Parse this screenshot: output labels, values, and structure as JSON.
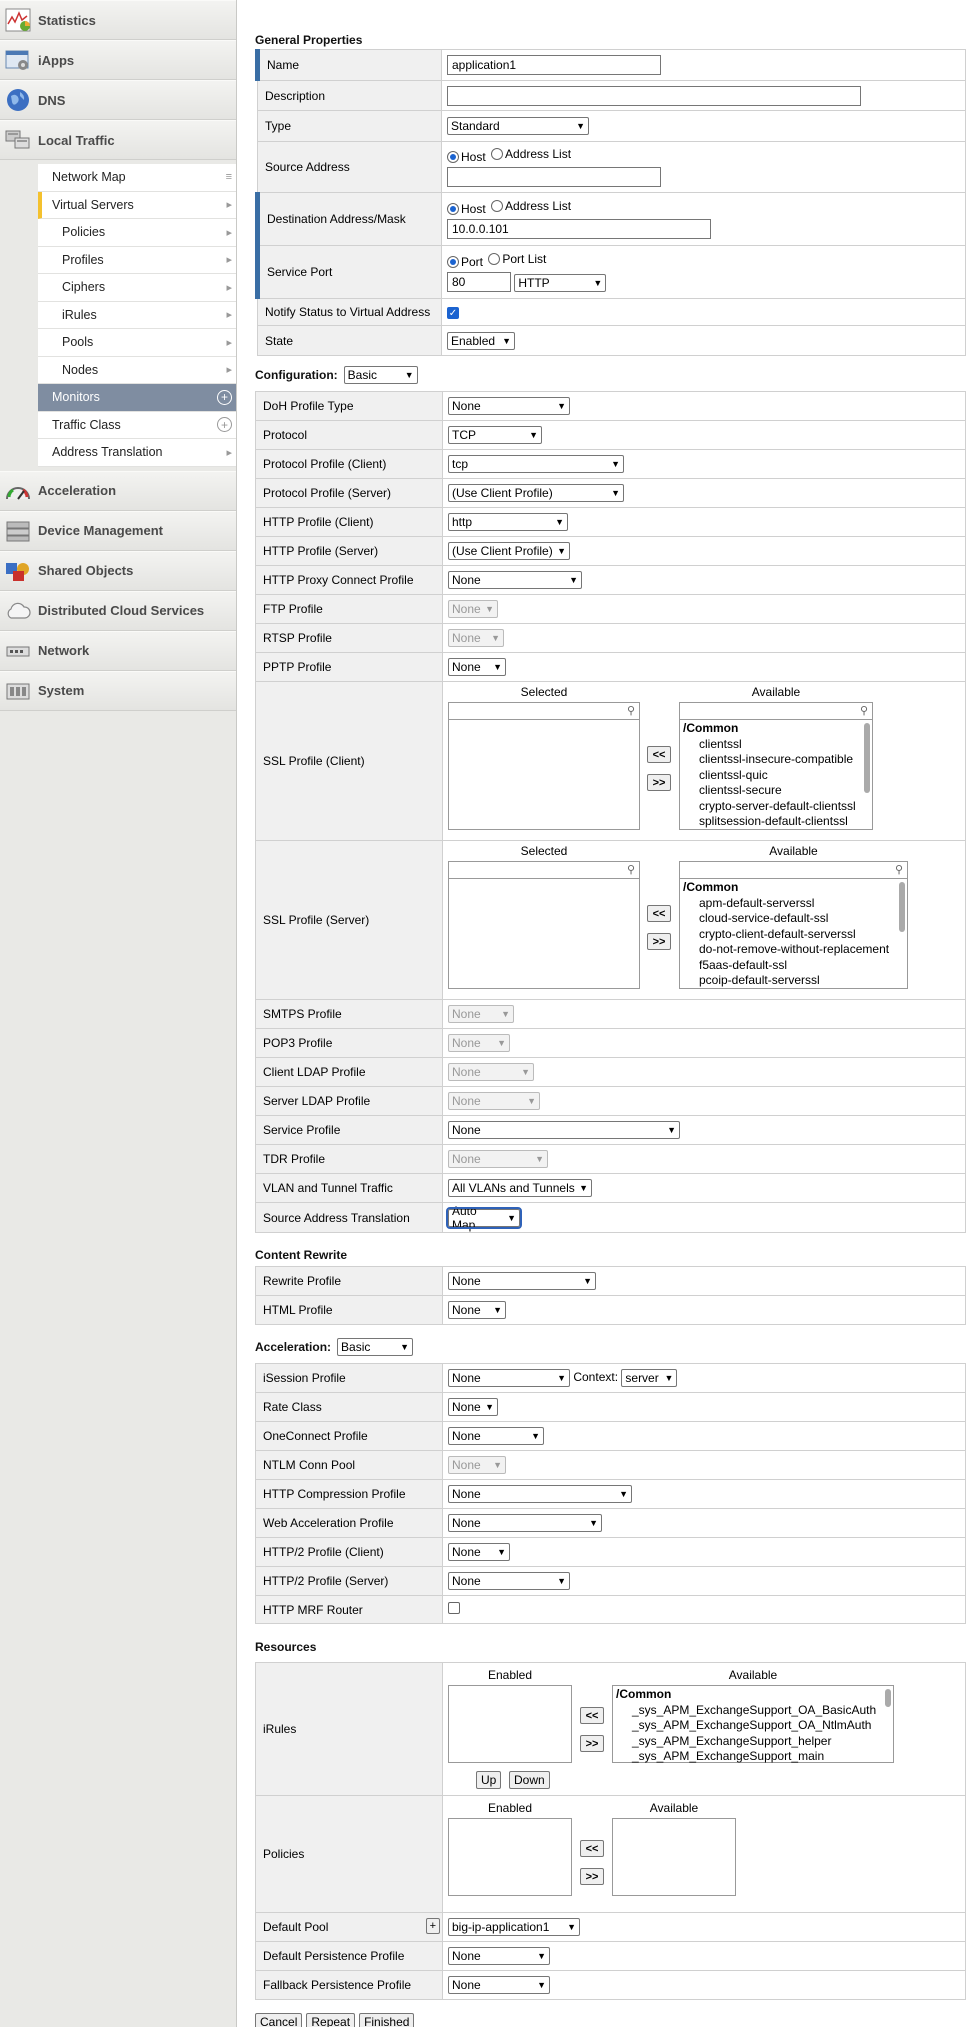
{
  "sidebar": {
    "sections_top": [
      {
        "label": "Statistics",
        "icon": "statistics-icon"
      },
      {
        "label": "iApps",
        "icon": "iapps-icon"
      },
      {
        "label": "DNS",
        "icon": "dns-icon"
      },
      {
        "label": "Local Traffic",
        "icon": "local-traffic-icon"
      }
    ],
    "local_traffic_items": [
      {
        "label": "Network Map",
        "kind": "menu"
      },
      {
        "label": "Virtual Servers",
        "kind": "chev"
      },
      {
        "label": "Policies",
        "kind": "chev"
      },
      {
        "label": "Profiles",
        "kind": "chev"
      },
      {
        "label": "Ciphers",
        "kind": "chev"
      },
      {
        "label": "iRules",
        "kind": "chev"
      },
      {
        "label": "Pools",
        "kind": "chev"
      },
      {
        "label": "Nodes",
        "kind": "chev"
      },
      {
        "label": "Monitors",
        "kind": "plus"
      },
      {
        "label": "Traffic Class",
        "kind": "plus"
      },
      {
        "label": "Address Translation",
        "kind": "chev"
      }
    ],
    "sections_bottom": [
      {
        "label": "Acceleration",
        "icon": "acceleration-icon"
      },
      {
        "label": "Device Management",
        "icon": "device-management-icon"
      },
      {
        "label": "Shared Objects",
        "icon": "shared-objects-icon"
      },
      {
        "label": "Distributed Cloud Services",
        "icon": "cloud-icon"
      },
      {
        "label": "Network",
        "icon": "network-icon"
      },
      {
        "label": "System",
        "icon": "system-icon"
      }
    ]
  },
  "general": {
    "title": "General Properties",
    "name_label": "Name",
    "name_value": "application1",
    "description_label": "Description",
    "description_value": "",
    "type_label": "Type",
    "type_value": "Standard",
    "source_label": "Source Address",
    "host_label": "Host",
    "address_list_label": "Address List",
    "source_value": "",
    "dest_label": "Destination Address/Mask",
    "dest_value": "10.0.0.101",
    "port_label": "Service Port",
    "port_opt": "Port",
    "port_list_opt": "Port List",
    "port_value": "80",
    "port_proto": "HTTP",
    "notify_label": "Notify Status to Virtual Address",
    "state_label": "State",
    "state_value": "Enabled"
  },
  "config": {
    "title": "Configuration:",
    "mode": "Basic",
    "doh_label": "DoH Profile Type",
    "doh_value": "None",
    "protocol_label": "Protocol",
    "protocol_value": "TCP",
    "ppc_label": "Protocol Profile (Client)",
    "ppc_value": "tcp",
    "pps_label": "Protocol Profile (Server)",
    "pps_value": "(Use Client Profile)",
    "hpc_label": "HTTP Profile (Client)",
    "hpc_value": "http",
    "hps_label": "HTTP Profile (Server)",
    "hps_value": "(Use Client Profile)",
    "hproxy_label": "HTTP Proxy Connect Profile",
    "hproxy_value": "None",
    "ftp_label": "FTP Profile",
    "ftp_value": "None",
    "rtsp_label": "RTSP Profile",
    "rtsp_value": "None",
    "pptp_label": "PPTP Profile",
    "pptp_value": "None",
    "sslc_label": "SSL Profile (Client)",
    "sslc_selected": "Selected",
    "sslc_available": "Available",
    "sslc_items": [
      "clientssl",
      "clientssl-insecure-compatible",
      "clientssl-quic",
      "clientssl-secure",
      "crypto-server-default-clientssl",
      "splitsession-default-clientssl"
    ],
    "ssls_label": "SSL Profile (Server)",
    "ssls_selected": "Selected",
    "ssls_available": "Available",
    "ssls_items": [
      "apm-default-serverssl",
      "cloud-service-default-ssl",
      "crypto-client-default-serverssl",
      "do-not-remove-without-replacement",
      "f5aas-default-ssl",
      "pcoip-default-serverssl"
    ],
    "common": "/Common",
    "smtps_label": "SMTPS Profile",
    "smtps_value": "None",
    "pop3_label": "POP3 Profile",
    "pop3_value": "None",
    "cldap_label": "Client LDAP Profile",
    "cldap_value": "None",
    "sldap_label": "Server LDAP Profile",
    "sldap_value": "None",
    "svc_label": "Service Profile",
    "svc_value": "None",
    "tdr_label": "TDR Profile",
    "tdr_value": "None",
    "vlan_label": "VLAN and Tunnel Traffic",
    "vlan_value": "All VLANs and Tunnels",
    "snat_label": "Source Address Translation",
    "snat_value": "Auto Map"
  },
  "rewrite": {
    "title": "Content Rewrite",
    "rw_label": "Rewrite Profile",
    "rw_value": "None",
    "html_label": "HTML Profile",
    "html_value": "None"
  },
  "accel": {
    "title": "Acceleration:",
    "mode": "Basic",
    "isess_label": "iSession Profile",
    "isess_value": "None",
    "context_label": "Context:",
    "context_value": "server",
    "rate_label": "Rate Class",
    "rate_value": "None",
    "oc_label": "OneConnect Profile",
    "oc_value": "None",
    "ntlm_label": "NTLM Conn Pool",
    "ntlm_value": "None",
    "hcomp_label": "HTTP Compression Profile",
    "hcomp_value": "None",
    "wa_label": "Web Acceleration Profile",
    "wa_value": "None",
    "h2c_label": "HTTP/2 Profile (Client)",
    "h2c_value": "None",
    "h2s_label": "HTTP/2 Profile (Server)",
    "h2s_value": "None",
    "mrf_label": "HTTP MRF Router"
  },
  "resources": {
    "title": "Resources",
    "irules_label": "iRules",
    "enabled": "Enabled",
    "available": "Available",
    "irules_items": [
      "_sys_APM_ExchangeSupport_OA_BasicAuth",
      "_sys_APM_ExchangeSupport_OA_NtlmAuth",
      "_sys_APM_ExchangeSupport_helper",
      "_sys_APM_ExchangeSupport_main"
    ],
    "up": "Up",
    "down": "Down",
    "policies_label": "Policies",
    "pool_label": "Default Pool",
    "pool_value": "big-ip-application1",
    "pool_plus": "+",
    "dpp_label": "Default Persistence Profile",
    "dpp_value": "None",
    "fpp_label": "Fallback Persistence Profile",
    "fpp_value": "None"
  },
  "buttons": {
    "cancel": "Cancel",
    "repeat": "Repeat",
    "finished": "Finished"
  },
  "move_left": "<<",
  "move_right": ">>"
}
